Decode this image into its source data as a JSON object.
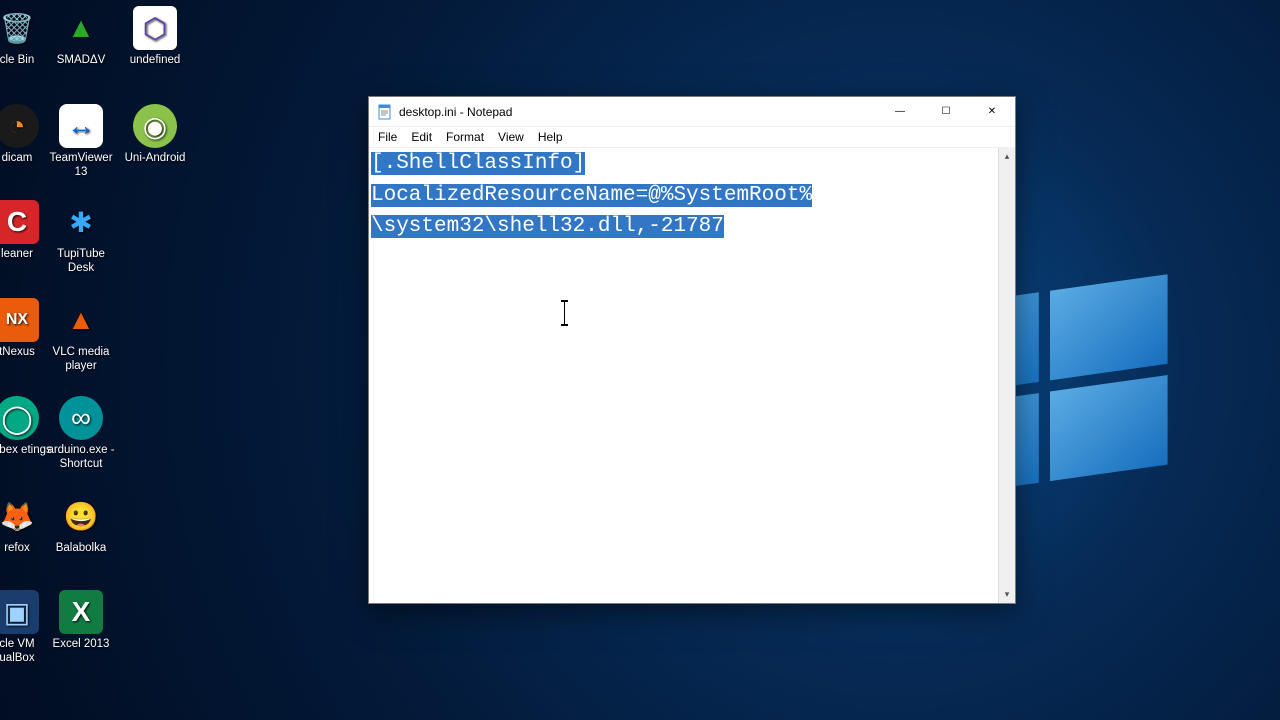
{
  "desktop_icons": {
    "col1": [
      {
        "label": "cle Bin",
        "glyph": "🗑️",
        "bg": ""
      },
      {
        "label": "dicam",
        "glyph": "◔",
        "bg": "#1a1a1a"
      },
      {
        "label": "leaner",
        "glyph": "C",
        "bg": "#d6262a"
      },
      {
        "label": "tNexus",
        "glyph": "NX",
        "bg": "#ea5b0c"
      },
      {
        "label": "Webex etings",
        "glyph": "◯",
        "bg": "#00a884"
      },
      {
        "label": "refox",
        "glyph": "🦊",
        "bg": ""
      },
      {
        "label": "cle VM ualBox",
        "glyph": "▣",
        "bg": "#1b3d6d"
      }
    ],
    "col2": [
      {
        "label": "SMADΔV",
        "glyph": "▲",
        "bg": "#2ca72c"
      },
      {
        "label": "TeamViewer 13",
        "glyph": "↔",
        "bg": "#0b63c6"
      },
      {
        "label": "TupiTube Desk",
        "glyph": "✱",
        "bg": ""
      },
      {
        "label": "VLC media player",
        "glyph": "▲",
        "bg": "#e85e00"
      },
      {
        "label": "arduino.exe - Shortcut",
        "glyph": "∞",
        "bg": "#009299"
      },
      {
        "label": "Balabolka",
        "glyph": "😀",
        "bg": ""
      },
      {
        "label": "Excel 2013",
        "glyph": "X",
        "bg": "#107c41"
      }
    ],
    "col3": [
      {
        "label": "undefined",
        "glyph": "⬡",
        "bg": "#ffffff"
      },
      {
        "label": "Uni-Android",
        "glyph": "◉",
        "bg": "#8bc34a"
      }
    ]
  },
  "notepad": {
    "title": "desktop.ini - Notepad",
    "menus": {
      "file": "File",
      "edit": "Edit",
      "format": "Format",
      "view": "View",
      "help": "Help"
    },
    "content_line1": "[.ShellClassInfo]",
    "content_line2a": "LocalizedResourceName=@%SystemRoot%",
    "content_line2b": "\\system32\\shell32.dll,-21787",
    "winbtns": {
      "min": "—",
      "max": "☐",
      "close": "✕"
    }
  }
}
